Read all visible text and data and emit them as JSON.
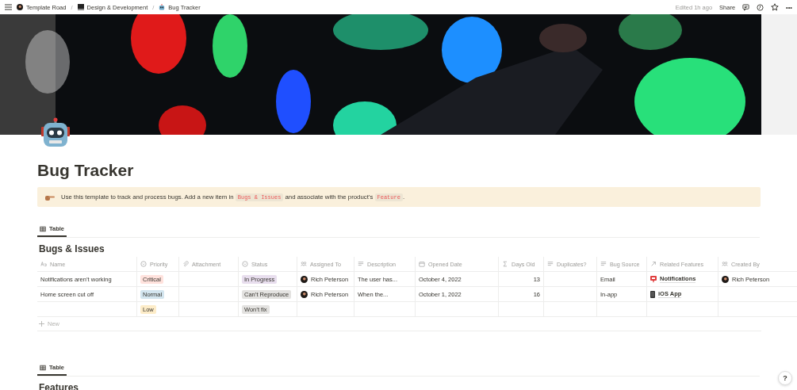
{
  "topbar": {
    "breadcrumbs": [
      {
        "text": "Template Road"
      },
      {
        "text": "Design & Development"
      },
      {
        "text": "Bug Tracker"
      }
    ],
    "separator": "/",
    "edited": "Edited 1h ago",
    "share": "Share",
    "more": "•••"
  },
  "page": {
    "title": "Bug Tracker"
  },
  "callout": {
    "parts": [
      {
        "kind": "text",
        "text": "Use this template to track and process bugs. Add a new item in "
      },
      {
        "kind": "code",
        "text": "Bugs & Issues"
      },
      {
        "kind": "text",
        "text": " and associate with the product’s "
      },
      {
        "kind": "code",
        "text": "Feature"
      },
      {
        "kind": "text",
        "text": "."
      }
    ]
  },
  "database": {
    "views": [
      {
        "label": "Table",
        "selected": true
      }
    ],
    "title": "Bugs & Issues",
    "columns": [
      {
        "kind": "title",
        "label": "Name"
      },
      {
        "kind": "select",
        "label": "Priority"
      },
      {
        "kind": "file",
        "label": "Attachment"
      },
      {
        "kind": "select",
        "label": "Status"
      },
      {
        "kind": "person",
        "label": "Assigned To"
      },
      {
        "kind": "text",
        "label": "Description"
      },
      {
        "kind": "date",
        "label": "Opened Date"
      },
      {
        "kind": "formula",
        "label": "Days Old"
      },
      {
        "kind": "text",
        "label": "Duplicates?"
      },
      {
        "kind": "text",
        "label": "Bug Source"
      },
      {
        "kind": "relation",
        "label": "Related Features"
      },
      {
        "kind": "person",
        "label": "Created By"
      }
    ],
    "rows": [
      [
        {
          "kind": "text",
          "text": "Notifications aren’t working"
        },
        {
          "kind": "tag",
          "text": "Critical",
          "color": "#ffe2dd"
        },
        {
          "kind": "empty"
        },
        {
          "kind": "tag",
          "text": "In Progress",
          "color": "#e8deee"
        },
        {
          "kind": "person",
          "text": "Rich Peterson"
        },
        {
          "kind": "text",
          "text": "The user has..."
        },
        {
          "kind": "text",
          "text": "October 4, 2022"
        },
        {
          "kind": "number",
          "text": "13"
        },
        {
          "kind": "empty"
        },
        {
          "kind": "text",
          "text": "Email"
        },
        {
          "kind": "relation",
          "text": "Notifications"
        },
        {
          "kind": "person",
          "text": "Rich Peterson"
        }
      ],
      [
        {
          "kind": "text",
          "text": "Home screen cut off"
        },
        {
          "kind": "tag",
          "text": "Normal",
          "color": "#d3e5ef"
        },
        {
          "kind": "empty"
        },
        {
          "kind": "tag",
          "text": "Can’t Reproduce",
          "color": "#e3e2e0"
        },
        {
          "kind": "person",
          "text": "Rich Peterson"
        },
        {
          "kind": "text",
          "text": "When the..."
        },
        {
          "kind": "text",
          "text": "October 1, 2022"
        },
        {
          "kind": "number",
          "text": "16"
        },
        {
          "kind": "empty"
        },
        {
          "kind": "text",
          "text": "In-app"
        },
        {
          "kind": "relation",
          "text": "iOS App"
        },
        {
          "kind": "empty"
        }
      ],
      [
        {
          "kind": "empty"
        },
        {
          "kind": "tag",
          "text": "Low",
          "color": "#fdecc8"
        },
        {
          "kind": "empty"
        },
        {
          "kind": "tag",
          "text": "Won’t fix",
          "color": "#e3e2e0"
        },
        {
          "kind": "empty"
        },
        {
          "kind": "empty"
        },
        {
          "kind": "empty"
        },
        {
          "kind": "empty"
        },
        {
          "kind": "empty"
        },
        {
          "kind": "empty"
        },
        {
          "kind": "empty"
        },
        {
          "kind": "empty"
        }
      ]
    ],
    "new_row": "New"
  },
  "database_2": {
    "views": [
      {
        "label": "Table",
        "selected": true
      }
    ],
    "title": "Features"
  },
  "help": "?"
}
